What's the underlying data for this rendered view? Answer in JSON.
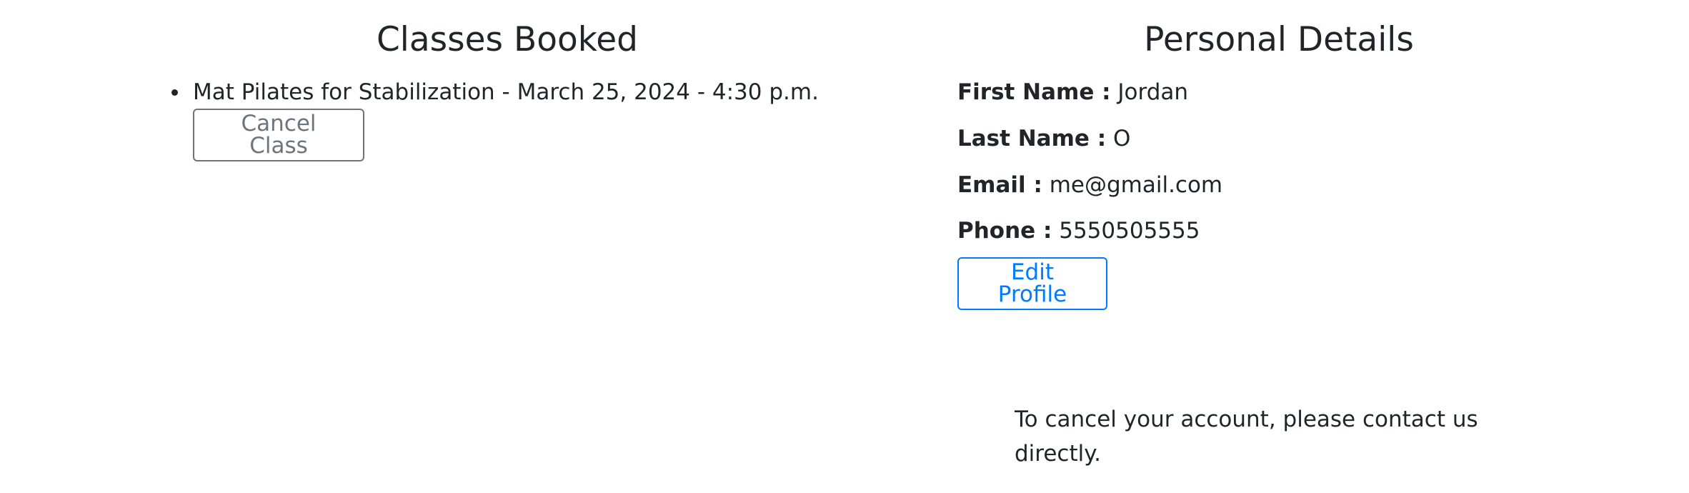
{
  "classes": {
    "title": "Classes Booked",
    "items": [
      {
        "label": "Mat Pilates for Stabilization - March 25, 2024 - 4:30 p.m."
      }
    ],
    "cancel_button": "Cancel Class"
  },
  "details": {
    "title": "Personal Details",
    "first_name_label": "First Name :",
    "first_name_value": "Jordan",
    "last_name_label": "Last Name :",
    "last_name_value": "O",
    "email_label": "Email :",
    "email_value": "me@gmail.com",
    "phone_label": "Phone :",
    "phone_value": "5550505555",
    "edit_button": "Edit Profile",
    "cancel_note": "To cancel your account, please contact us directly."
  },
  "colors": {
    "text": "#212529",
    "primary": "#007bff",
    "secondary": "#6c757d"
  }
}
